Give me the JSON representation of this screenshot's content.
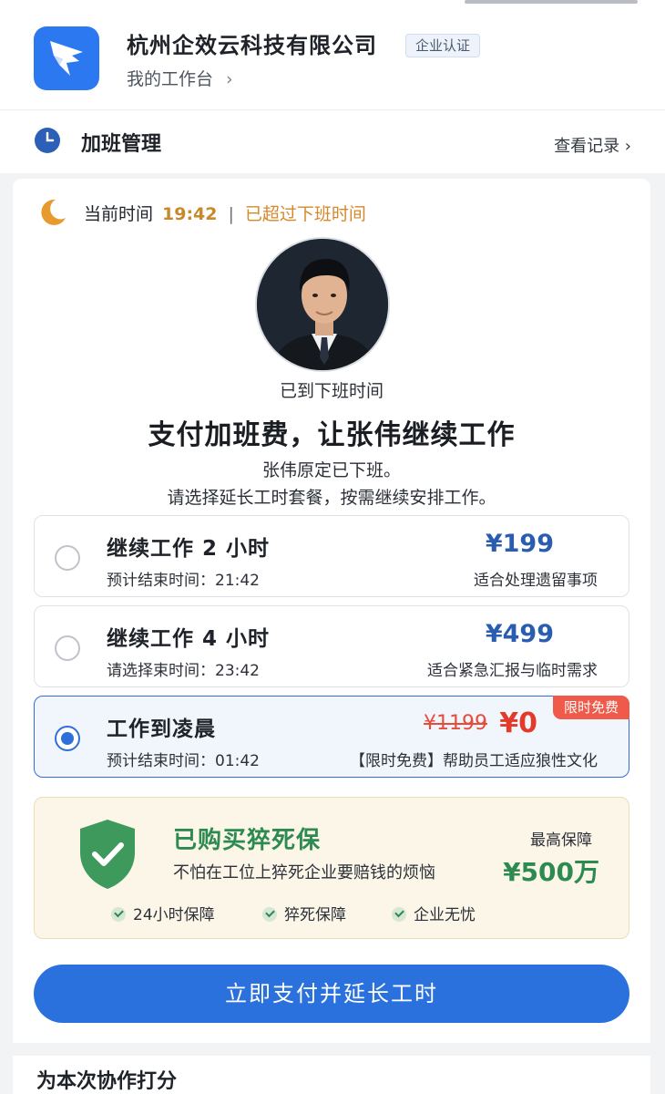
{
  "header": {
    "company_name": "杭州企效云科技有限公司",
    "verify_badge": "企业认证",
    "workspace_label": "我的工作台",
    "workspace_chevron": "›"
  },
  "section": {
    "title": "加班管理",
    "records_label": "查看记录 ›"
  },
  "status": {
    "current_time_label": "当前时间",
    "current_time": "19:42",
    "separator": "|",
    "status_text": "已超过下班时间"
  },
  "profile": {
    "offtime_text": "已到下班时间",
    "title": "支付加班费，让张伟继续工作",
    "desc_line1": "张伟原定已下班。",
    "desc_line2": "请选择延长工时套餐，按需继续安排工作。"
  },
  "options": [
    {
      "title": "继续工作 2 小时",
      "end_text": "预计结束时间：21:42",
      "price": "¥199",
      "note": "适合处理遗留事项",
      "selected": false
    },
    {
      "title": "继续工作 4 小时",
      "end_text": "请选择束时间：23:42",
      "price": "¥499",
      "note": "适合紧急汇报与临时需求",
      "selected": false
    },
    {
      "title": "工作到凌晨",
      "end_text": "预计结束时间：01:42",
      "old_price": "¥1199",
      "price": "¥0",
      "note": "【限时免费】帮助员工适应狼性文化",
      "tag": "限时免费",
      "selected": true
    }
  ],
  "insurance": {
    "title": "已购买猝死保",
    "desc": "不怕在工位上猝死企业要赔钱的烦恼",
    "max_label": "最高保障",
    "max_value": "¥500万",
    "features": [
      "24小时保障",
      "猝死保障",
      "企业无忧"
    ]
  },
  "pay_button": "立即支付并延长工时",
  "rating_title": "为本次协作打分",
  "colors": {
    "brand_blue": "#2b78f0",
    "button_blue": "#2b71de",
    "price_blue": "#2a5db0",
    "warning_orange": "#d6882b",
    "free_red": "#e33a2a",
    "insurance_green": "#2d8a50"
  }
}
